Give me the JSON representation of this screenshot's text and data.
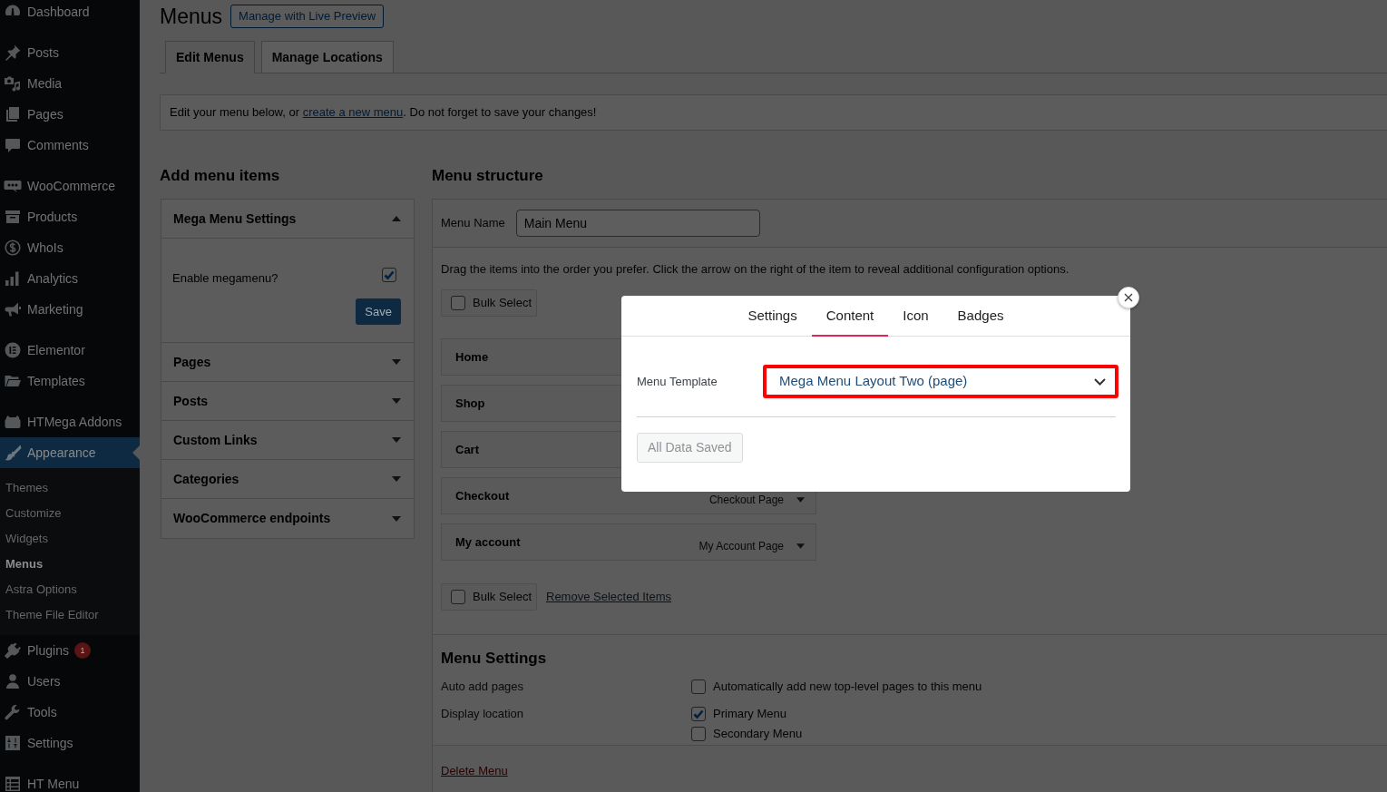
{
  "sidebar": {
    "groups": [
      {
        "items": [
          {
            "label": "Dashboard",
            "selected": false
          }
        ]
      },
      {
        "items": [
          {
            "label": "Posts",
            "selected": false
          },
          {
            "label": "Media",
            "selected": false
          },
          {
            "label": "Pages",
            "selected": false
          },
          {
            "label": "Comments",
            "selected": false
          }
        ]
      },
      {
        "items": [
          {
            "label": "WooCommerce",
            "selected": false
          },
          {
            "label": "Products",
            "selected": false
          },
          {
            "label": "WhoIs",
            "selected": false
          },
          {
            "label": "Analytics",
            "selected": false
          },
          {
            "label": "Marketing",
            "selected": false
          }
        ]
      },
      {
        "items": [
          {
            "label": "Elementor",
            "selected": false
          },
          {
            "label": "Templates",
            "selected": false
          }
        ]
      },
      {
        "items": [
          {
            "label": "HTMega Addons",
            "selected": false
          },
          {
            "label": "Appearance",
            "selected": true,
            "children": [
              {
                "label": "Themes",
                "selected": false
              },
              {
                "label": "Customize",
                "selected": false
              },
              {
                "label": "Widgets",
                "selected": false
              },
              {
                "label": "Menus",
                "selected": true
              },
              {
                "label": "Astra Options",
                "selected": false
              },
              {
                "label": "Theme File Editor",
                "selected": false
              }
            ]
          },
          {
            "label": "Plugins",
            "selected": false,
            "badge": "1"
          },
          {
            "label": "Users",
            "selected": false
          },
          {
            "label": "Tools",
            "selected": false
          },
          {
            "label": "Settings",
            "selected": false
          }
        ]
      },
      {
        "items": [
          {
            "label": "HT Menu",
            "selected": false
          }
        ]
      }
    ]
  },
  "page": {
    "title": "Menus",
    "preview_button": "Manage with Live Preview"
  },
  "tabs": [
    {
      "label": "Edit Menus",
      "selected": true
    },
    {
      "label": "Manage Locations",
      "selected": false
    }
  ],
  "notice": {
    "before": "Edit your menu below, or ",
    "link": "create a new menu",
    "after": ". Do not forget to save your changes!"
  },
  "add_menu_items": {
    "title": "Add menu items",
    "sections": [
      {
        "title": "Mega Menu Settings",
        "expanded": true,
        "option": {
          "label": "Enable megamenu?",
          "checked": true
        },
        "button": "Save"
      },
      {
        "title": "Pages",
        "expanded": false
      },
      {
        "title": "Posts",
        "expanded": false
      },
      {
        "title": "Custom Links",
        "expanded": false
      },
      {
        "title": "Categories",
        "expanded": false
      },
      {
        "title": "WooCommerce endpoints",
        "expanded": false
      }
    ]
  },
  "menu_structure": {
    "title": "Menu structure",
    "menu_name_label": "Menu Name",
    "menu_name": "Main Menu",
    "instructions": "Drag the items into the order you prefer. Click the arrow on the right of the item to reveal additional configuration options.",
    "top_bulk_select": {
      "label": "Bulk Select",
      "checked": false
    },
    "items": [
      {
        "label": "Home"
      },
      {
        "label": "Shop"
      },
      {
        "label": "Cart"
      },
      {
        "label": "Checkout",
        "type": "Checkout Page"
      },
      {
        "label": "My account",
        "type": "My Account Page"
      }
    ],
    "bottom_bulk_select": {
      "label": "Bulk Select",
      "checked": false
    },
    "remove_link": "Remove Selected Items",
    "settings": {
      "title": "Menu Settings",
      "rows": [
        {
          "label": "Auto add pages",
          "options": [
            {
              "label": "Automatically add new top-level pages to this menu",
              "checked": false
            }
          ]
        },
        {
          "label": "Display location",
          "options": [
            {
              "label": "Primary Menu",
              "checked": true
            },
            {
              "label": "Secondary Menu",
              "checked": false
            }
          ]
        }
      ]
    },
    "delete_link": "Delete Menu"
  },
  "modal": {
    "tabs": [
      {
        "label": "Settings",
        "selected": false
      },
      {
        "label": "Content",
        "selected": true
      },
      {
        "label": "Icon",
        "selected": false
      },
      {
        "label": "Badges",
        "selected": false
      }
    ],
    "field_label": "Menu Template",
    "select": {
      "value": "Mega Menu Layout Two (page)",
      "highlighted": true
    },
    "button": {
      "label": "All Data Saved",
      "disabled": true
    }
  }
}
